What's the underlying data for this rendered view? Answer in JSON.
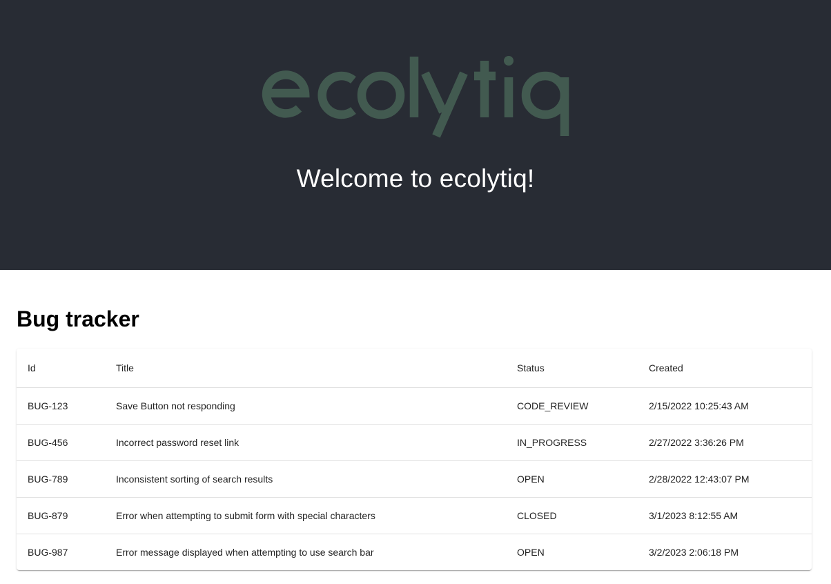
{
  "header": {
    "logo_text": "ecolytiq",
    "welcome": "Welcome to ecolytiq!"
  },
  "colors": {
    "hero_background": "#282c34",
    "logo_green": "#425a50",
    "welcome_text": "#ffffff"
  },
  "tracker": {
    "title": "Bug tracker",
    "columns": [
      "Id",
      "Title",
      "Status",
      "Created"
    ],
    "rows": [
      [
        "BUG-123",
        "Save Button not responding",
        "CODE_REVIEW",
        "2/15/2022 10:25:43 AM"
      ],
      [
        "BUG-456",
        "Incorrect password reset link",
        "IN_PROGRESS",
        "2/27/2022 3:36:26 PM"
      ],
      [
        "BUG-789",
        "Inconsistent sorting of search results",
        "OPEN",
        "2/28/2022 12:43:07 PM"
      ],
      [
        "BUG-879",
        "Error when attempting to submit form with special characters",
        "CLOSED",
        "3/1/2023 8:12:55 AM"
      ],
      [
        "BUG-987",
        "Error message displayed when attempting to use search bar",
        "OPEN",
        "3/2/2023 2:06:18 PM"
      ]
    ]
  }
}
